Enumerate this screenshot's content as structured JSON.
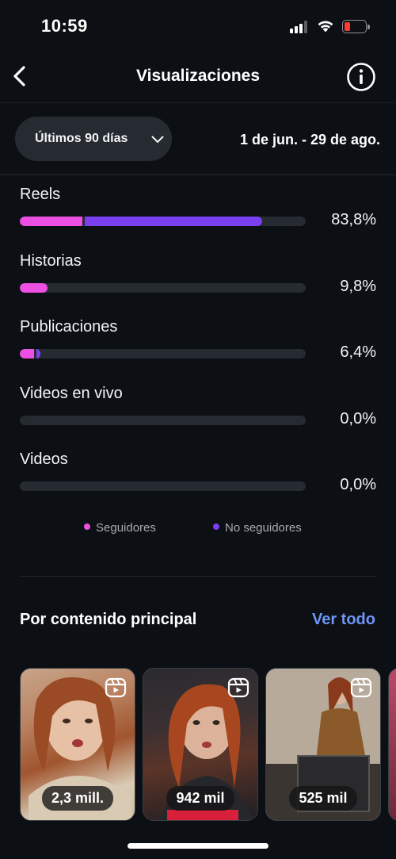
{
  "status_bar": {
    "time": "10:59"
  },
  "header": {
    "title": "Visualizaciones"
  },
  "filter": {
    "range_label": "Últimos 90 días",
    "date_range": "1 de jun. - 29 de ago."
  },
  "breakdown": [
    {
      "label": "Reels",
      "percent_text": "83,8%",
      "followers_fraction": 0.218,
      "non_followers_fraction": 0.62
    },
    {
      "label": "Historias",
      "percent_text": "9,8%",
      "followers_fraction": 0.098,
      "non_followers_fraction": 0.0
    },
    {
      "label": "Publicaciones",
      "percent_text": "6,4%",
      "followers_fraction": 0.05,
      "non_followers_fraction": 0.014
    },
    {
      "label": "Videos en vivo",
      "percent_text": "0,0%",
      "followers_fraction": 0.0,
      "non_followers_fraction": 0.0
    },
    {
      "label": "Videos",
      "percent_text": "0,0%",
      "followers_fraction": 0.0,
      "non_followers_fraction": 0.0
    }
  ],
  "legend": {
    "followers": "Seguidores",
    "non_followers": "No seguidores"
  },
  "colors": {
    "followers": "#ec4fe1",
    "non_followers": "#7b3ff2",
    "link": "#6d97f6"
  },
  "top_content": {
    "title": "Por contenido principal",
    "see_all": "Ver todo",
    "items": [
      {
        "views": "2,3 mill.",
        "icon": "reel-icon"
      },
      {
        "views": "942 mil",
        "icon": "reel-icon"
      },
      {
        "views": "525 mil",
        "icon": "reel-icon"
      }
    ]
  }
}
